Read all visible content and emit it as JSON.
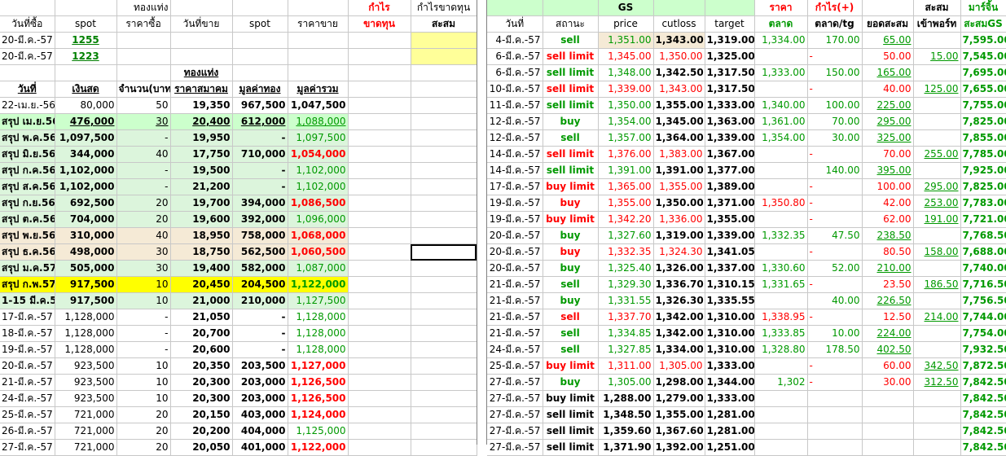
{
  "left": {
    "header_rows": [
      [
        "",
        "",
        "ทองแท่ง",
        "",
        "",
        "",
        "กำไร",
        "กำไรขาดทุน"
      ],
      [
        "วันที่ซื้อ",
        "spot",
        "ราคาซื้อ",
        "วันที่ขาย",
        "spot",
        "ราคาขาย",
        "ขาดทุน",
        "สะสม"
      ],
      [
        "20-มี.ค.-57",
        "1255",
        "",
        "",
        "",
        "",
        "",
        ""
      ],
      [
        "20-มี.ค.-57",
        "1223",
        "",
        "",
        "",
        "",
        "",
        ""
      ],
      [
        "",
        "",
        "",
        "ทองแท่ง",
        "",
        "",
        "",
        ""
      ],
      [
        "วันที่",
        "เงินสด",
        "จำนวน(บาท",
        "ราคาสมาคม",
        "มูลค่าทอง",
        "มูลค่ารวม",
        "",
        ""
      ]
    ],
    "rows": [
      [
        "22-เม.ย.-56",
        "80,000",
        "50",
        "19,350",
        "967,500",
        "1,047,500"
      ],
      [
        "สรุป เม.ย.56",
        "476,000",
        "30",
        "20,400",
        "612,000",
        "1,088,000"
      ],
      [
        "สรุป พ.ค.56",
        "1,097,500",
        "-",
        "19,950",
        "-",
        "1,097,500"
      ],
      [
        "สรุป มิ.ย.56",
        "344,000",
        "40",
        "17,750",
        "710,000",
        "1,054,000"
      ],
      [
        "สรุป ก.ค.56",
        "1,102,000",
        "-",
        "19,500",
        "-",
        "1,102,000"
      ],
      [
        "สรุป ส.ค.56",
        "1,102,000",
        "-",
        "21,200",
        "-",
        "1,102,000"
      ],
      [
        "สรุป ก.ย.56",
        "692,500",
        "20",
        "19,700",
        "394,000",
        "1,086,500"
      ],
      [
        "สรุป ต.ค.56",
        "704,000",
        "20",
        "19,600",
        "392,000",
        "1,096,000"
      ],
      [
        "สรุป พ.ย.56",
        "310,000",
        "40",
        "18,950",
        "758,000",
        "1,068,000"
      ],
      [
        "สรุป ธ.ค.56",
        "498,000",
        "30",
        "18,750",
        "562,500",
        "1,060,500"
      ],
      [
        "สรุป ม.ค.57",
        "505,000",
        "30",
        "19,400",
        "582,000",
        "1,087,000"
      ],
      [
        "สรุป ก.พ.57",
        "917,500",
        "10",
        "20,450",
        "204,500",
        "1,122,000"
      ],
      [
        "1-15 มี.ค.57",
        "917,500",
        "10",
        "21,000",
        "210,000",
        "1,127,500"
      ],
      [
        "17-มี.ค.-57",
        "1,128,000",
        "-",
        "21,050",
        "-",
        "1,128,000"
      ],
      [
        "18-มี.ค.-57",
        "1,128,000",
        "-",
        "20,700",
        "-",
        "1,128,000"
      ],
      [
        "19-มี.ค.-57",
        "1,128,000",
        "-",
        "20,600",
        "-",
        "1,128,000"
      ],
      [
        "20-มี.ค.-57",
        "923,500",
        "10",
        "20,350",
        "203,500",
        "1,127,000"
      ],
      [
        "21-มี.ค.-57",
        "923,500",
        "10",
        "20,300",
        "203,000",
        "1,126,500"
      ],
      [
        "24-มี.ค.-57",
        "923,500",
        "10",
        "20,300",
        "203,000",
        "1,126,500"
      ],
      [
        "25-มี.ค.-57",
        "721,000",
        "20",
        "20,150",
        "403,000",
        "1,124,000"
      ],
      [
        "26-มี.ค.-57",
        "721,000",
        "20",
        "20,200",
        "404,000",
        "1,125,000"
      ],
      [
        "27-มี.ค.-57",
        "721,000",
        "20",
        "20,050",
        "401,000",
        "1,122,000"
      ]
    ]
  },
  "right": {
    "header_rows": [
      [
        "",
        "",
        "GS",
        "",
        "",
        "ราคา",
        "กำไร(+)",
        "",
        "สะสม",
        "มาร์จิ้น"
      ],
      [
        "วันที่",
        "สถานะ",
        "price",
        "cutloss",
        "target",
        "ตลาด",
        "ตลาด/tg",
        "ยอดสะสม",
        "เข้าพอร์ท",
        "สะสมGS"
      ]
    ],
    "rows": [
      [
        "4-มี.ค.-57",
        "sell",
        "1,351.00",
        "1,343.00",
        "1,319.00",
        "1,334.00",
        "170.00",
        "65.00",
        "",
        "7,595.00"
      ],
      [
        "6-มี.ค.-57",
        "sell limit",
        "1,345.00",
        "1,350.00",
        "1,325.00",
        "",
        "-",
        "50.00",
        "15.00",
        "7,545.00"
      ],
      [
        "6-มี.ค.-57",
        "sell limit",
        "1,348.00",
        "1,342.50",
        "1,317.50",
        "1,333.00",
        "150.00",
        "165.00",
        "",
        "7,695.00"
      ],
      [
        "10-มี.ค.-57",
        "sell limit",
        "1,339.00",
        "1,343.00",
        "1,317.50",
        "",
        "-",
        "40.00",
        "125.00",
        "7,655.00"
      ],
      [
        "11-มี.ค.-57",
        "sell limit",
        "1,350.00",
        "1,355.00",
        "1,333.00",
        "1,340.00",
        "100.00",
        "225.00",
        "",
        "7,755.00"
      ],
      [
        "12-มี.ค.-57",
        "buy",
        "1,354.00",
        "1,345.00",
        "1,363.00",
        "1,361.00",
        "70.00",
        "295.00",
        "",
        "7,825.00"
      ],
      [
        "12-มี.ค.-57",
        "sell",
        "1,357.00",
        "1,364.00",
        "1,339.00",
        "1,354.00",
        "30.00",
        "325.00",
        "",
        "7,855.00"
      ],
      [
        "14-มี.ค.-57",
        "sell limit",
        "1,376.00",
        "1,383.00",
        "1,367.00",
        "",
        "-",
        "70.00",
        "255.00",
        "7,785.00"
      ],
      [
        "14-มี.ค.-57",
        "sell limit",
        "1,391.00",
        "1,391.00",
        "1,377.00",
        "",
        "140.00",
        "395.00",
        "",
        "7,925.00"
      ],
      [
        "17-มี.ค.-57",
        "buy limit",
        "1,365.00",
        "1,355.00",
        "1,389.00",
        "",
        "-",
        "100.00",
        "295.00",
        "7,825.00"
      ],
      [
        "19-มี.ค.-57",
        "buy",
        "1,355.00",
        "1,350.00",
        "1,371.00",
        "1,350.80",
        "-",
        "42.00",
        "253.00",
        "7,783.00"
      ],
      [
        "19-มี.ค.-57",
        "buy limit",
        "1,342.20",
        "1,336.00",
        "1,355.00",
        "",
        "-",
        "62.00",
        "191.00",
        "7,721.00"
      ],
      [
        "20-มี.ค.-57",
        "buy",
        "1,327.60",
        "1,319.00",
        "1,339.00",
        "1,332.35",
        "47.50",
        "238.50",
        "",
        "7,768.50"
      ],
      [
        "20-มี.ค.-57",
        "buy",
        "1,332.35",
        "1,324.30",
        "1,341.05",
        "",
        "-",
        "80.50",
        "158.00",
        "7,688.00"
      ],
      [
        "20-มี.ค.-57",
        "buy",
        "1,325.40",
        "1,326.00",
        "1,337.00",
        "1,330.60",
        "52.00",
        "210.00",
        "",
        "7,740.00"
      ],
      [
        "21-มี.ค.-57",
        "sell",
        "1,329.30",
        "1,336.70",
        "1,310.15",
        "1,331.65",
        "-",
        "23.50",
        "186.50",
        "7,716.50"
      ],
      [
        "21-มี.ค.-57",
        "buy",
        "1,331.55",
        "1,326.30",
        "1,335.55",
        "",
        "40.00",
        "226.50",
        "",
        "7,756.50"
      ],
      [
        "21-มี.ค.-57",
        "sell",
        "1,337.70",
        "1,342.00",
        "1,310.00",
        "1,338.95",
        "-",
        "12.50",
        "214.00",
        "7,744.00"
      ],
      [
        "21-มี.ค.-57",
        "sell",
        "1,334.85",
        "1,342.00",
        "1,310.00",
        "1,333.85",
        "10.00",
        "224.00",
        "",
        "7,754.00"
      ],
      [
        "24-มี.ค.-57",
        "sell",
        "1,327.85",
        "1,334.00",
        "1,310.00",
        "1,328.80",
        "178.50",
        "402.50",
        "",
        "7,932.50"
      ],
      [
        "25-มี.ค.-57",
        "buy limit",
        "1,311.00",
        "1,305.00",
        "1,333.00",
        "",
        "-",
        "60.00",
        "342.50",
        "7,872.50"
      ],
      [
        "27-มี.ค.-57",
        "buy",
        "1,305.00",
        "1,298.00",
        "1,344.00",
        "1,302",
        "-",
        "30.00",
        "312.50",
        "7,842.50"
      ],
      [
        "27-มี.ค.-57",
        "buy limit",
        "1,288.00",
        "1,279.00",
        "1,333.00",
        "",
        "",
        "",
        "",
        "7,842.50"
      ],
      [
        "27-มี.ค.-57",
        "sell limit",
        "1,348.50",
        "1,355.00",
        "1,281.00",
        "",
        "",
        "",
        "",
        "7,842.50"
      ],
      [
        "27-มี.ค.-57",
        "sell limit",
        "1,359.60",
        "1,367.60",
        "1,281.00",
        "",
        "",
        "",
        "",
        "7,842.50"
      ],
      [
        "27-มี.ค.-57",
        "sell limit",
        "1,371.90",
        "1,392.00",
        "1,251.00",
        "",
        "",
        "",
        "",
        "7,842.50"
      ]
    ]
  },
  "colors": {
    "green": "#009900",
    "red": "#ff0000",
    "light_green": "#ccffcc",
    "yellow": "#ffff00",
    "pale_yellow": "#ffff99"
  }
}
